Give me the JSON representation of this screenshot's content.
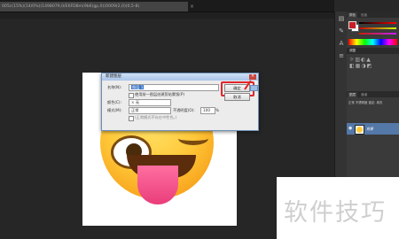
{
  "doc_tab": {
    "title": "005c(15%)(14/0%)(1498079,0/EKFD8m(9b6)gp,0)(0009(2,0)(0,5-8)",
    "close": "×"
  },
  "dialog": {
    "title": "新建图层",
    "close": "✕",
    "name_label": "名称(N):",
    "name_value": "图层 1",
    "clip_label": "使用前一图层创建剪贴蒙版(P)",
    "color_label": "颜色(C):",
    "color_value": "× 无",
    "mode_label": "模式(M):",
    "mode_value": "正常",
    "opacity_label": "不透明度(O):",
    "opacity_value": "100",
    "opacity_unit": "%",
    "neutral_label": "(正常模式不存在中性色。)",
    "ok_label": "确定",
    "cancel_label": "取消"
  },
  "panels": {
    "color_tab": "颜色",
    "swatches_tab": "色板",
    "adjustments_title": "调整",
    "layers_tab": "图层",
    "channels_tab": "通道",
    "layer_name": "背景",
    "layer_opts": "正常  不透明度  锁定:  填充"
  },
  "watermark": {
    "text": "软件技巧"
  },
  "colors": {
    "highlight": "#e0262a",
    "foreground": "#c81d25",
    "layer_selected": "#5478a8"
  }
}
